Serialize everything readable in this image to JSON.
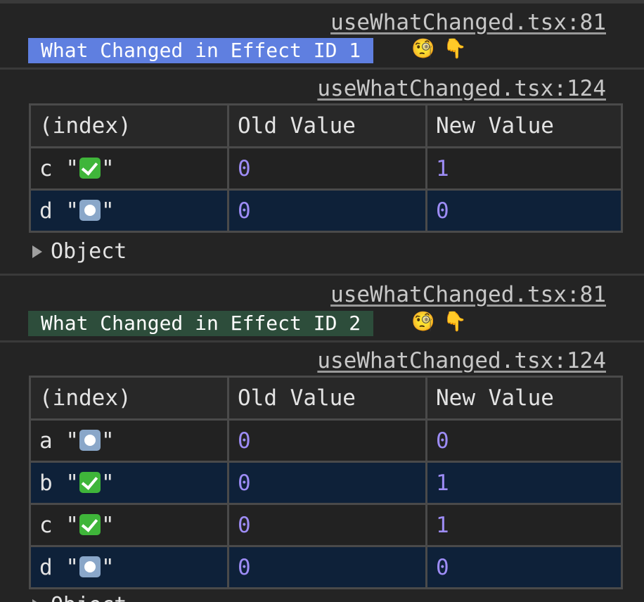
{
  "colors": {
    "badge1_bg": "#5f7fe0",
    "badge2_bg": "#2d4d3b",
    "number": "#9d8cf5",
    "row_highlight": "#0e2139"
  },
  "entries": [
    {
      "source": "useWhatChanged.tsx:81",
      "label": "What Changed in Effect ID 1",
      "emojis": [
        "🧐",
        "👇"
      ]
    },
    {
      "source": "useWhatChanged.tsx:124",
      "columns": [
        "(index)",
        "Old Value",
        "New Value"
      ],
      "rows": [
        {
          "key": "c",
          "status_icon": "check-mark-icon",
          "old": "0",
          "new": "1"
        },
        {
          "key": "d",
          "status_icon": "radio-button-icon",
          "old": "0",
          "new": "0"
        }
      ],
      "object_label": "Object"
    },
    {
      "source": "useWhatChanged.tsx:81",
      "label": "What Changed in Effect ID 2",
      "emojis": [
        "🧐",
        "👇"
      ]
    },
    {
      "source": "useWhatChanged.tsx:124",
      "columns": [
        "(index)",
        "Old Value",
        "New Value"
      ],
      "rows": [
        {
          "key": "a",
          "status_icon": "radio-button-icon",
          "old": "0",
          "new": "0"
        },
        {
          "key": "b",
          "status_icon": "check-mark-icon",
          "old": "0",
          "new": "1"
        },
        {
          "key": "c",
          "status_icon": "check-mark-icon",
          "old": "0",
          "new": "1"
        },
        {
          "key": "d",
          "status_icon": "radio-button-icon",
          "old": "0",
          "new": "0"
        }
      ],
      "object_label": "Object"
    }
  ]
}
